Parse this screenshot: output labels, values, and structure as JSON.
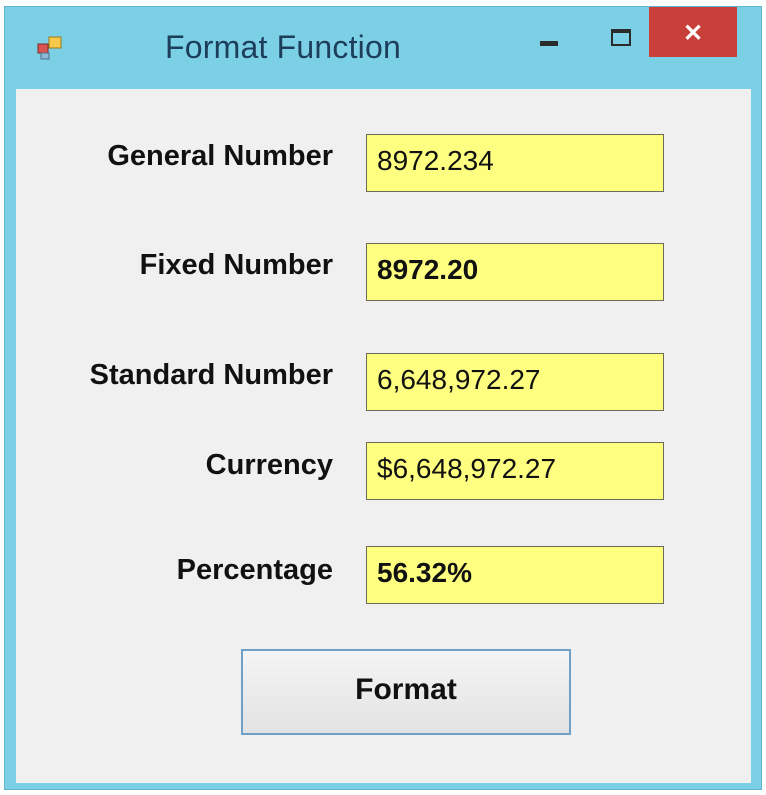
{
  "window": {
    "title": "Format Function",
    "close_glyph": "✕"
  },
  "fields": [
    {
      "label": "General Number",
      "value": "8972.234"
    },
    {
      "label": "Fixed Number",
      "value": "8972.20"
    },
    {
      "label": "Standard Number",
      "value": "6,648,972.27"
    },
    {
      "label": "Currency",
      "value": "$6,648,972.27"
    },
    {
      "label": "Percentage",
      "value": "56.32%"
    }
  ],
  "button": {
    "label": "Format"
  },
  "colors": {
    "titlebar": "#7cd0e6",
    "field_bg": "#fefe80",
    "close": "#c9403b",
    "client": "#f0f0f0"
  },
  "icons": [
    "app-icon",
    "minimize-icon",
    "maximize-icon",
    "close-icon"
  ]
}
